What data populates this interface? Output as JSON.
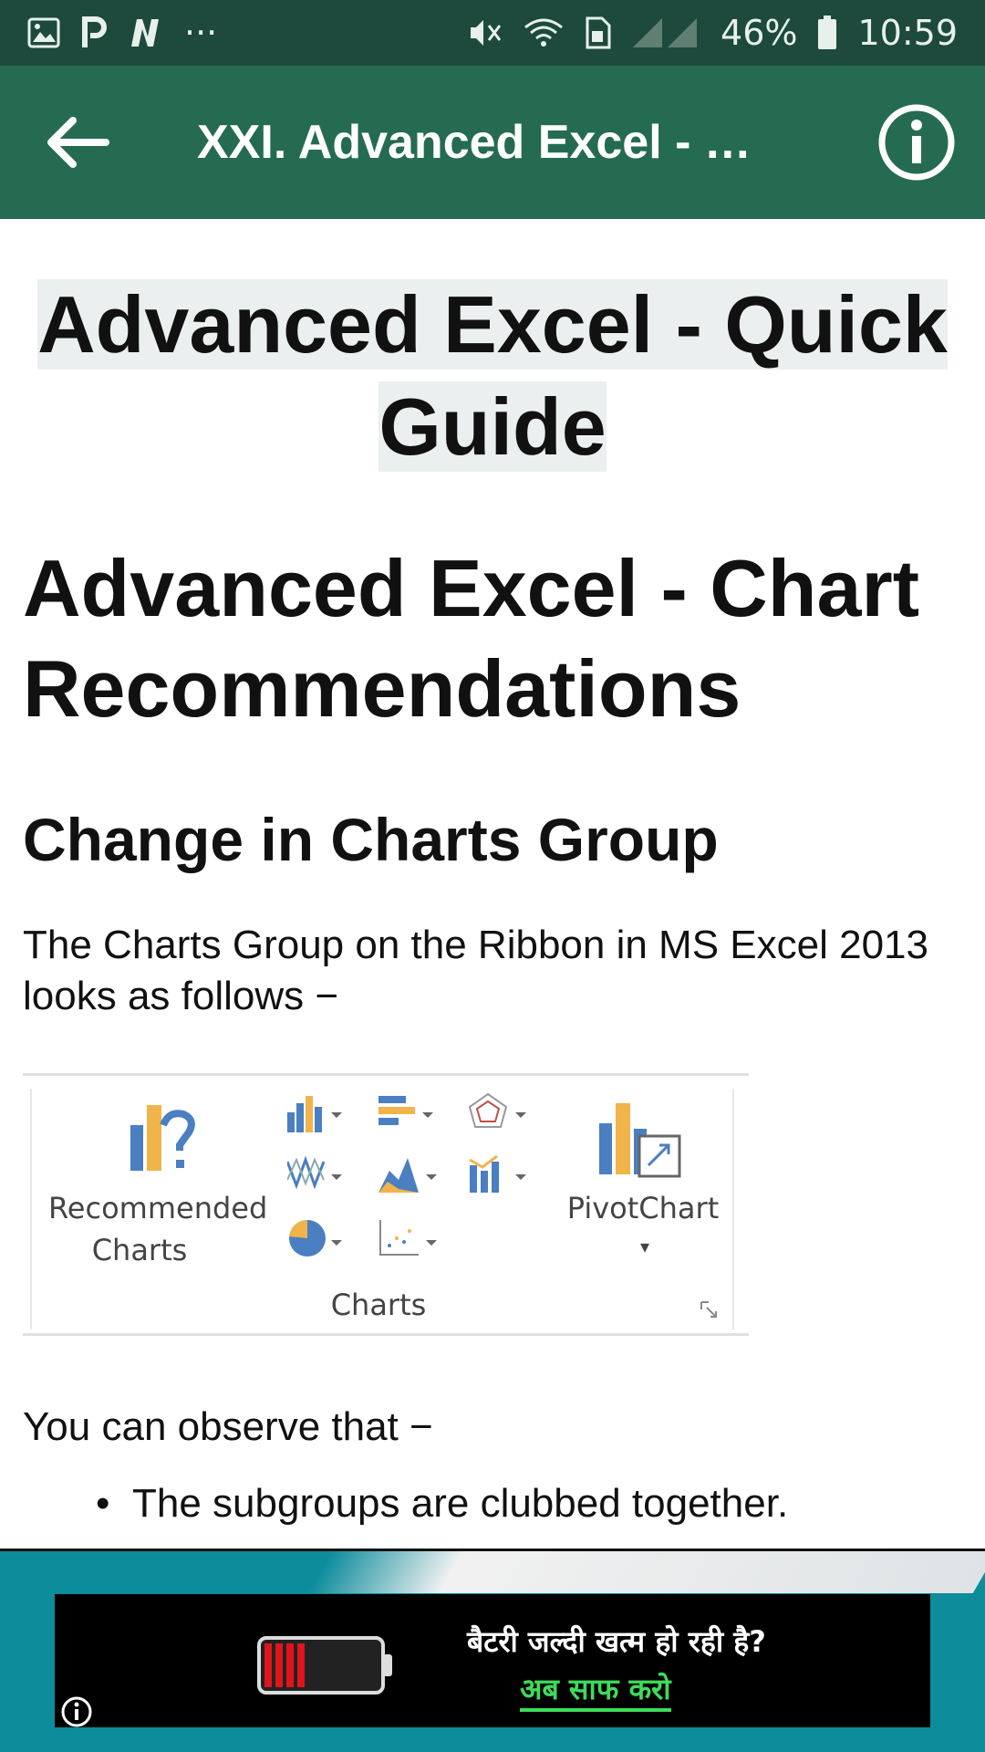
{
  "status_bar": {
    "battery": "46%",
    "time": "10:59",
    "overflow": "···",
    "icons": [
      "image-icon",
      "p-icon",
      "n-icon",
      "vibrate-icon",
      "wifi-icon",
      "sim-icon",
      "signal-icon",
      "battery-icon"
    ]
  },
  "app_bar": {
    "title": "XXI. Advanced Excel - …",
    "back_icon": "arrow-back-icon",
    "info_icon": "info-icon"
  },
  "content": {
    "page_title": "Advanced Excel - Quick Guide",
    "heading1": "Advanced Excel - Chart Recommendations",
    "heading2": "Change in Charts Group",
    "paragraph1": "The Charts Group on the Ribbon in MS Excel 2013 looks as follows −",
    "ribbon": {
      "recommended_line1": "Recommended",
      "recommended_line2": "Charts",
      "pivot": "PivotChart",
      "group_label": "Charts"
    },
    "paragraph2": "You can observe that −",
    "bullet1": "The subgroups are clubbed together."
  },
  "ad": {
    "line1": "बैटरी जल्दी खत्म हो रही है?",
    "line2": "अब साफ करो",
    "info_icon": "info-icon"
  },
  "colors": {
    "status_bar": "#1d4a3c",
    "app_bar": "#246b52",
    "ad_background": "#0d8c9c"
  }
}
